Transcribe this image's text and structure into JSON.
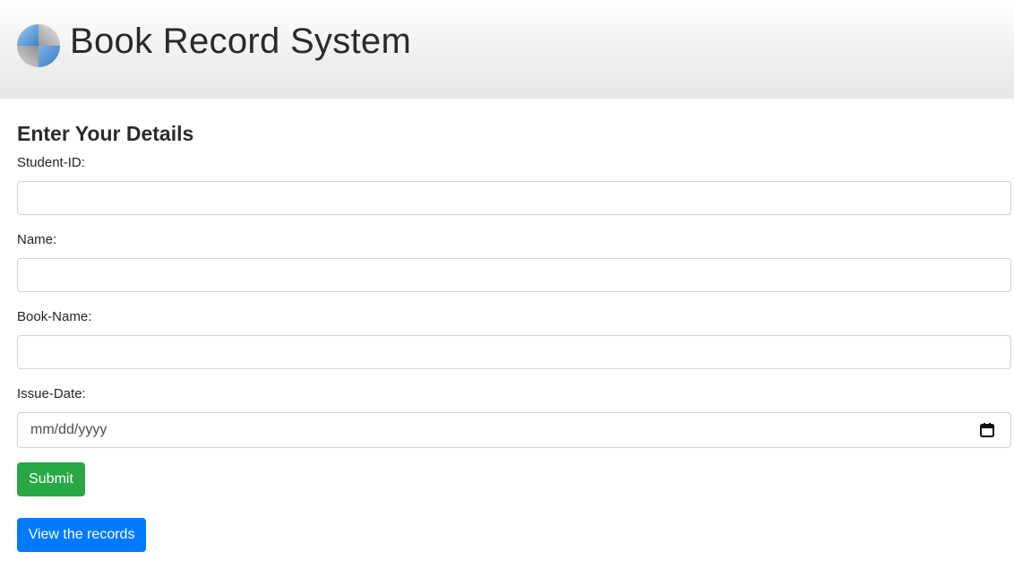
{
  "header": {
    "title": "Book Record System",
    "logo_icon": "globe-logo-icon"
  },
  "form": {
    "heading": "Enter Your Details",
    "fields": [
      {
        "label": "Student-ID:",
        "value": "",
        "placeholder": ""
      },
      {
        "label": "Name:",
        "value": "",
        "placeholder": ""
      },
      {
        "label": "Book-Name:",
        "value": "",
        "placeholder": ""
      },
      {
        "label": "Issue-Date:",
        "value": "",
        "placeholder": "mm/dd/yyyy"
      }
    ],
    "submit_label": "Submit",
    "view_records_label": "View the records"
  },
  "colors": {
    "submit": "#28a745",
    "view_records": "#007bff",
    "input_border": "#ced4da"
  }
}
